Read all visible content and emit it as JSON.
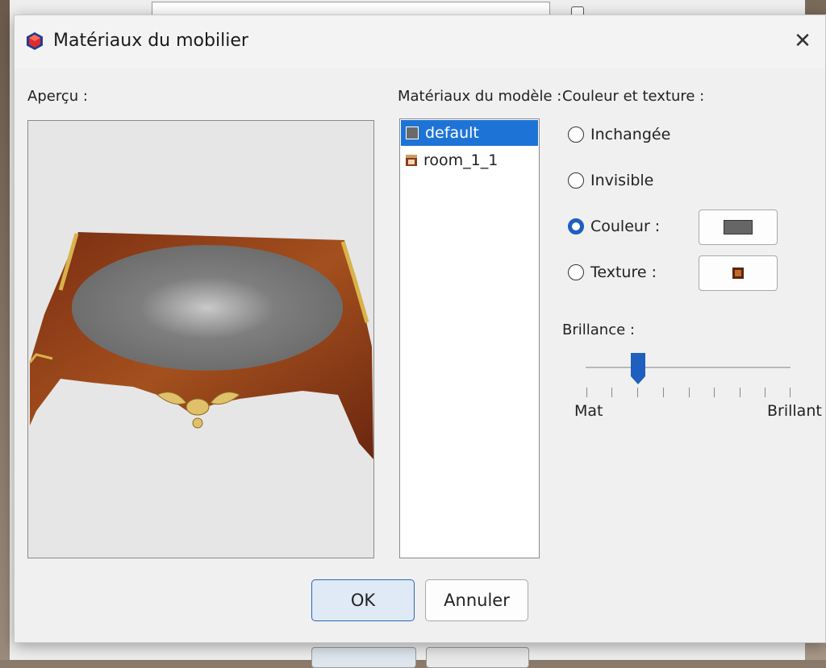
{
  "dialog": {
    "title": "Matériaux du mobilier",
    "close_glyph": "✕"
  },
  "preview": {
    "label": "Aperçu :"
  },
  "materials": {
    "label": "Matériaux du modèle :",
    "items": [
      {
        "name": "default",
        "selected": true,
        "swatch_color": "#6a6a6a"
      },
      {
        "name": "room_1_1",
        "selected": false,
        "swatch_color": "#8a3a1a"
      }
    ]
  },
  "color_texture": {
    "label": "Couleur et texture :",
    "options": [
      {
        "label": "Inchangée",
        "checked": false
      },
      {
        "label": "Invisible",
        "checked": false
      },
      {
        "label": "Couleur :",
        "checked": true
      },
      {
        "label": "Texture :",
        "checked": false
      }
    ],
    "color_value": "#666666"
  },
  "shininess": {
    "label": "Brillance :",
    "min_label": "Mat",
    "max_label": "Brillant",
    "value_fraction": 0.25
  },
  "buttons": {
    "ok": "OK",
    "cancel": "Annuler"
  },
  "colors": {
    "accent": "#1e74d6",
    "radio_checked": "#1e5fbf",
    "wood": "#8a3a1a",
    "table_top": "#7a7a7a"
  }
}
